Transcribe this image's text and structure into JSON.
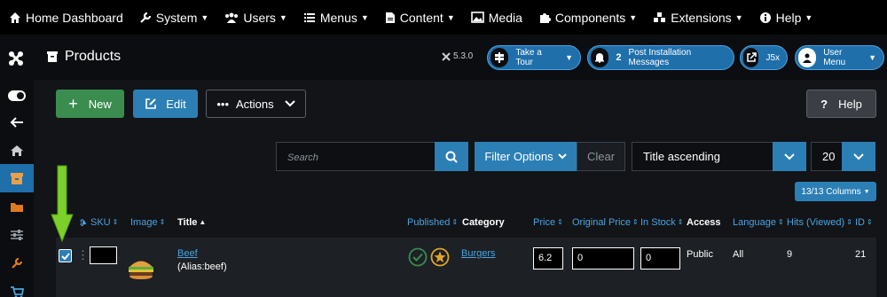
{
  "topbar": {
    "items": [
      {
        "label": "Home Dashboard",
        "icon": "home-icon"
      },
      {
        "label": "System",
        "icon": "wrench-icon"
      },
      {
        "label": "Users",
        "icon": "users-icon"
      },
      {
        "label": "Menus",
        "icon": "list-icon"
      },
      {
        "label": "Content",
        "icon": "file-icon"
      },
      {
        "label": "Media",
        "icon": "image-icon"
      },
      {
        "label": "Components",
        "icon": "puzzle-icon"
      },
      {
        "label": "Extensions",
        "icon": "cubes-icon"
      },
      {
        "label": "Help",
        "icon": "info-icon"
      }
    ]
  },
  "header": {
    "title": "Products",
    "version": "5.3.0",
    "take_tour": "Take a Tour",
    "post_install_count": "2",
    "post_install": "Post Installation Messages",
    "j5x": "J5x",
    "user_menu": "User Menu"
  },
  "toolbar": {
    "new_label": "New",
    "edit_label": "Edit",
    "actions_label": "Actions",
    "help_label": "Help"
  },
  "filters": {
    "search_placeholder": "Search",
    "filter_options": "Filter Options",
    "clear": "Clear",
    "ordering": "Title ascending",
    "limit": "20",
    "columns": "13/13 Columns"
  },
  "table": {
    "headers": {
      "sku": "SKU",
      "image": "Image",
      "title": "Title",
      "published": "Published",
      "category": "Category",
      "price": "Price",
      "original_price": "Original Price",
      "in_stock": "In Stock",
      "access": "Access",
      "language": "Language",
      "hits": "Hits (Viewed)",
      "id": "ID"
    },
    "rows": [
      {
        "title": "Beef",
        "alias": "(Alias:beef)",
        "category": "Burgers",
        "price": "6.2",
        "original_price": "0",
        "in_stock": "0",
        "access": "Public",
        "language": "All",
        "hits": "9",
        "id": "21",
        "checked": true
      }
    ]
  },
  "colors": {
    "accent": "#2b7fb5",
    "success": "#3a8c4f",
    "arrow": "#7bd12a",
    "star": "#e0a526"
  }
}
